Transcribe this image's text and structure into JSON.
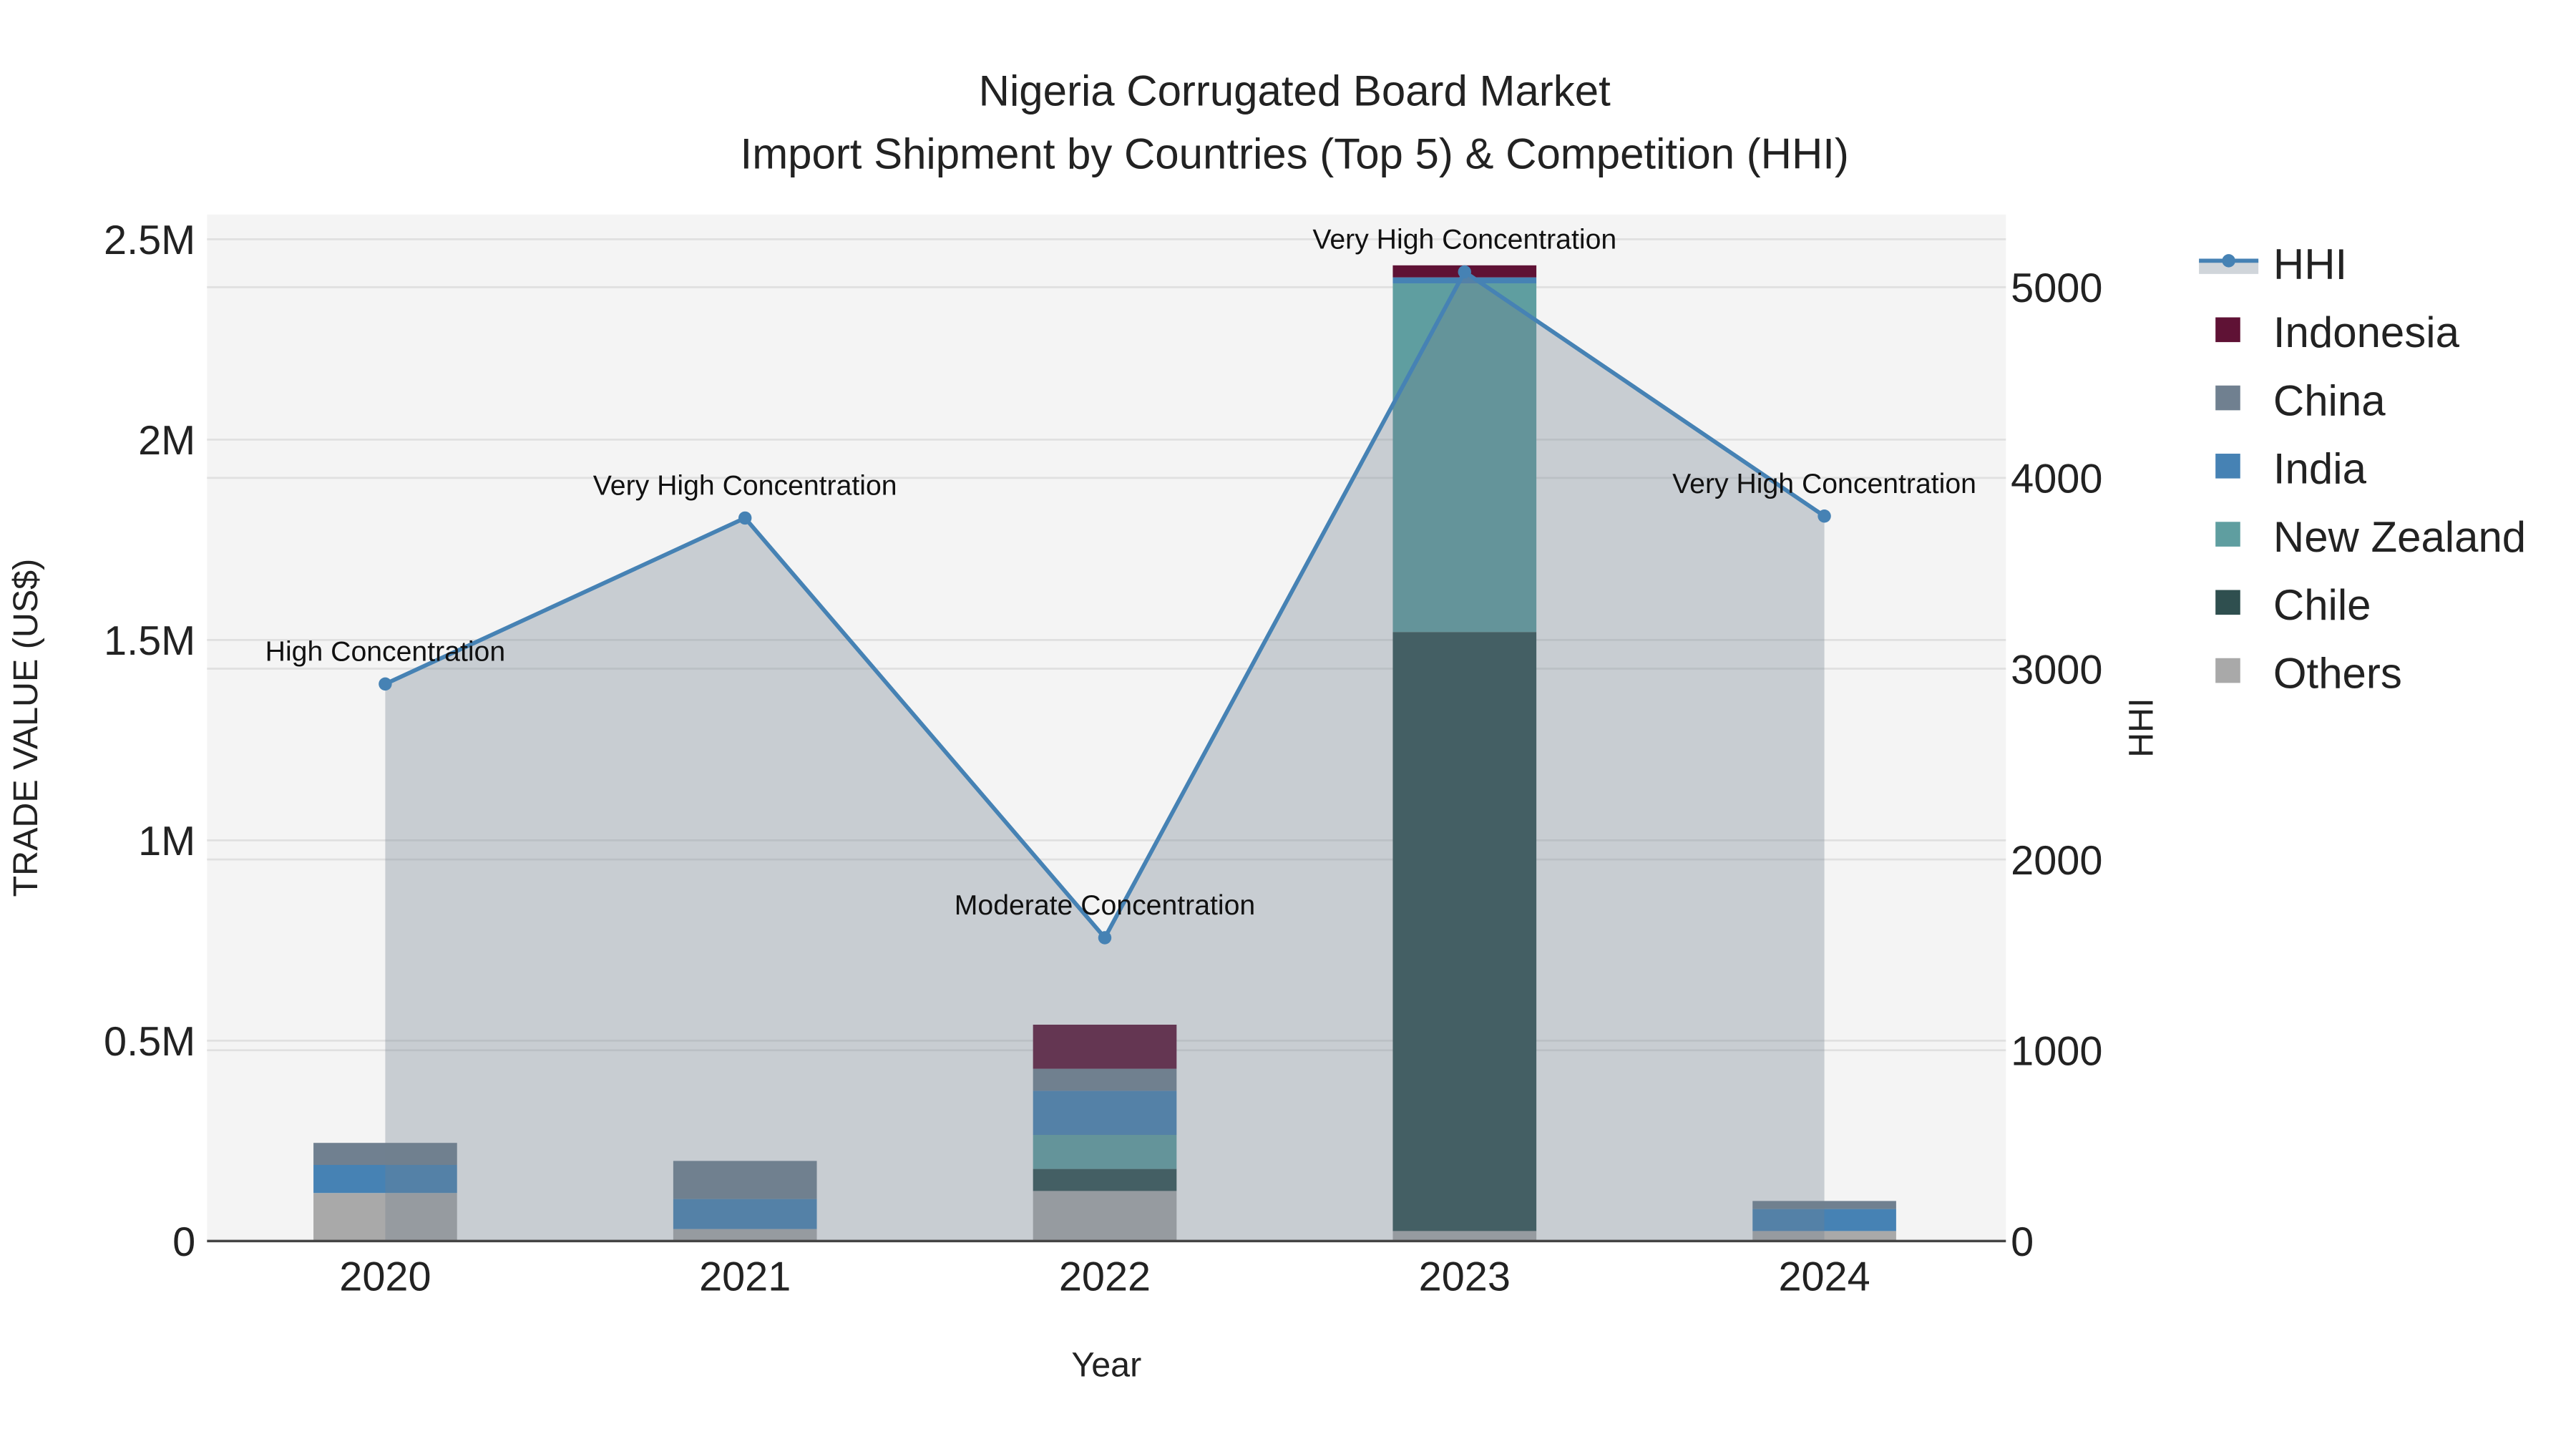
{
  "chart_data": {
    "type": "bar",
    "title": "Nigeria Corrugated Board Market",
    "subtitle": "Import Shipment by Countries (Top 5) & Competition (HHI)",
    "xlabel": "Year",
    "ylabel": "TRADE VALUE (US$)",
    "y2label": "HHI",
    "categories": [
      "2020",
      "2021",
      "2022",
      "2023",
      "2024"
    ],
    "ylim": [
      0,
      2500000
    ],
    "y_ticks": [
      0,
      500000,
      1000000,
      1500000,
      2000000,
      2500000
    ],
    "y_tick_labels": [
      "0",
      "0.5M",
      "1M",
      "1.5M",
      "2M",
      "2.5M"
    ],
    "y2lim": [
      0,
      5390
    ],
    "y2_ticks": [
      0,
      1000,
      2000,
      3000,
      4000,
      5000
    ],
    "y2_tick_labels": [
      "0",
      "1000",
      "2000",
      "3000",
      "4000",
      "5000"
    ],
    "stacked": true,
    "series": [
      {
        "name": "Others",
        "color": "#a9a9a9",
        "values": [
          120000,
          30000,
          125000,
          25000,
          25000
        ]
      },
      {
        "name": "Chile",
        "color": "#2f4f4f",
        "values": [
          0,
          0,
          55000,
          1495000,
          0
        ]
      },
      {
        "name": "New Zealand",
        "color": "#5f9ea0",
        "values": [
          0,
          0,
          85000,
          870000,
          0
        ]
      },
      {
        "name": "India",
        "color": "#4682b4",
        "values": [
          70000,
          75000,
          110000,
          15000,
          55000
        ]
      },
      {
        "name": "China",
        "color": "#708090",
        "values": [
          55000,
          95000,
          55000,
          0,
          20000
        ]
      },
      {
        "name": "Indonesia",
        "color": "#5f1235",
        "values": [
          0,
          0,
          110000,
          30000,
          0
        ]
      }
    ],
    "hhi": {
      "name": "HHI",
      "color": "#4682b4",
      "values": [
        2920,
        3790,
        1590,
        5080,
        3800
      ],
      "annotations": [
        "High Concentration",
        "Very High Concentration",
        "Moderate Concentration",
        "Very High Concentration",
        "Very High Concentration"
      ]
    },
    "legend_order": [
      "HHI",
      "Indonesia",
      "China",
      "India",
      "New Zealand",
      "Chile",
      "Others"
    ],
    "legend_placement": "right",
    "grid": true
  }
}
